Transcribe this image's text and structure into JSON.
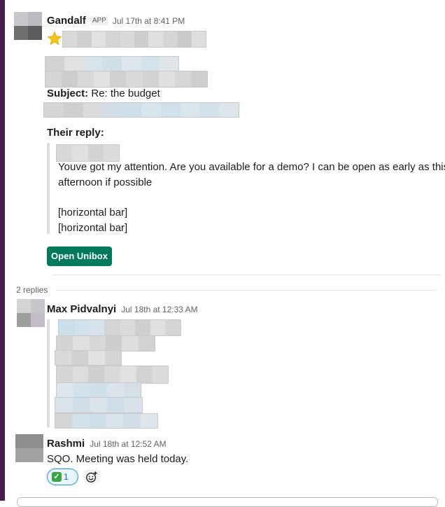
{
  "message1": {
    "author": "Gandalf",
    "app_tag": "APP",
    "timestamp": "Jul 17th at 8:41 PM",
    "star_icon": "star-emoji",
    "subject_label": "Subject:",
    "subject_value": "Re: the budget",
    "their_reply_label": "Their reply:",
    "reply_line1": "Youve got my attention. Are you available for a demo? I can be open as early as this",
    "reply_line2": "afternoon if possible",
    "reply_line3": "[horizontal bar]",
    "reply_line4": "[horizontal bar]",
    "button_label": "Open Unibox"
  },
  "replies_count": "2 replies",
  "reply1": {
    "author": "Max Pidvalnyi",
    "timestamp": "Jul 18th at 12:33 AM"
  },
  "reply2": {
    "author": "Rashmi",
    "timestamp": "Jul 18th at 12:52 AM",
    "text": "SQO. Meeting was held today.",
    "reaction_emoji": "white-check-mark",
    "reaction_count": "1"
  },
  "colors": {
    "sidebar": "#4a1d4d",
    "button": "#007a5a",
    "reaction_border": "#1d9bd1"
  }
}
